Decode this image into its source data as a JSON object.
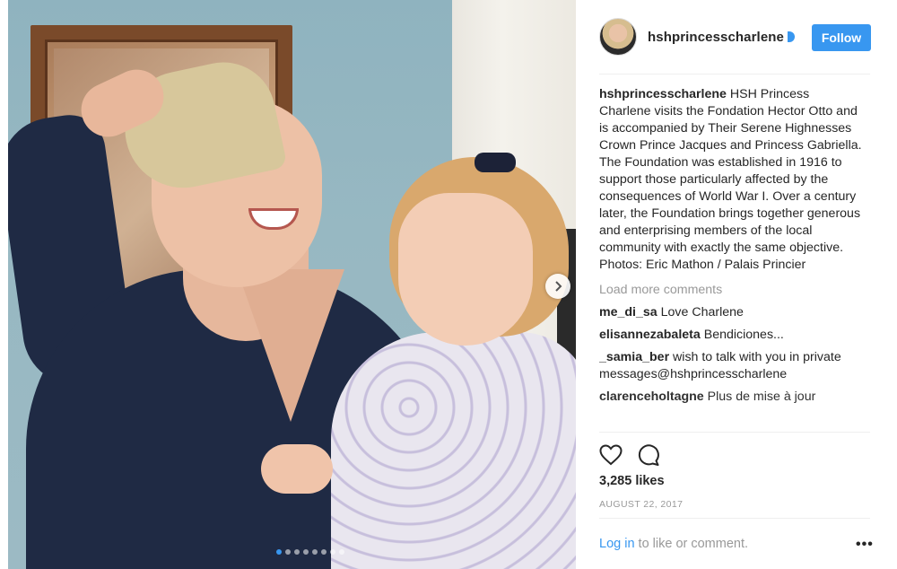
{
  "post": {
    "username": "hshprincesscharlene",
    "follow_label": "Follow",
    "caption_user": "hshprincesscharlene",
    "caption_text": "HSH Princess Charlene visits the Fondation Hector Otto and is accompanied by Their Serene Highnesses Crown Prince Jacques and Princess Gabriella. The Foundation was established in 1916 to support those particularly affected by the consequences of World War I. Over a century later, the Foundation brings together generous and enterprising members of the local community with exactly the same objective.\nPhotos: Eric Mathon / Palais Princier",
    "load_more_label": "Load more comments",
    "comments": [
      {
        "user": "me_di_sa",
        "text": "Love Charlene"
      },
      {
        "user": "elisannezabaleta",
        "text": "Bendiciones..."
      },
      {
        "user": "_samia_ber",
        "text": "wish to talk with you in private messages@hshprincesscharlene"
      },
      {
        "user": "clarenceholtagne",
        "text": "Plus de mise à jour"
      }
    ],
    "likes": "3,285 likes",
    "date": "AUGUST 22, 2017",
    "login_link": "Log in",
    "login_rest": " to like or comment.",
    "more_options": "•••"
  },
  "carousel": {
    "total_slides": 8,
    "active_slide": 1
  },
  "icons": {
    "heart": "heart-icon",
    "comment": "comment-icon",
    "next": "chevron-right-icon",
    "verified": "verified-badge-icon"
  },
  "colors": {
    "accent": "#3897f0",
    "muted": "#999999",
    "text": "#262626"
  }
}
